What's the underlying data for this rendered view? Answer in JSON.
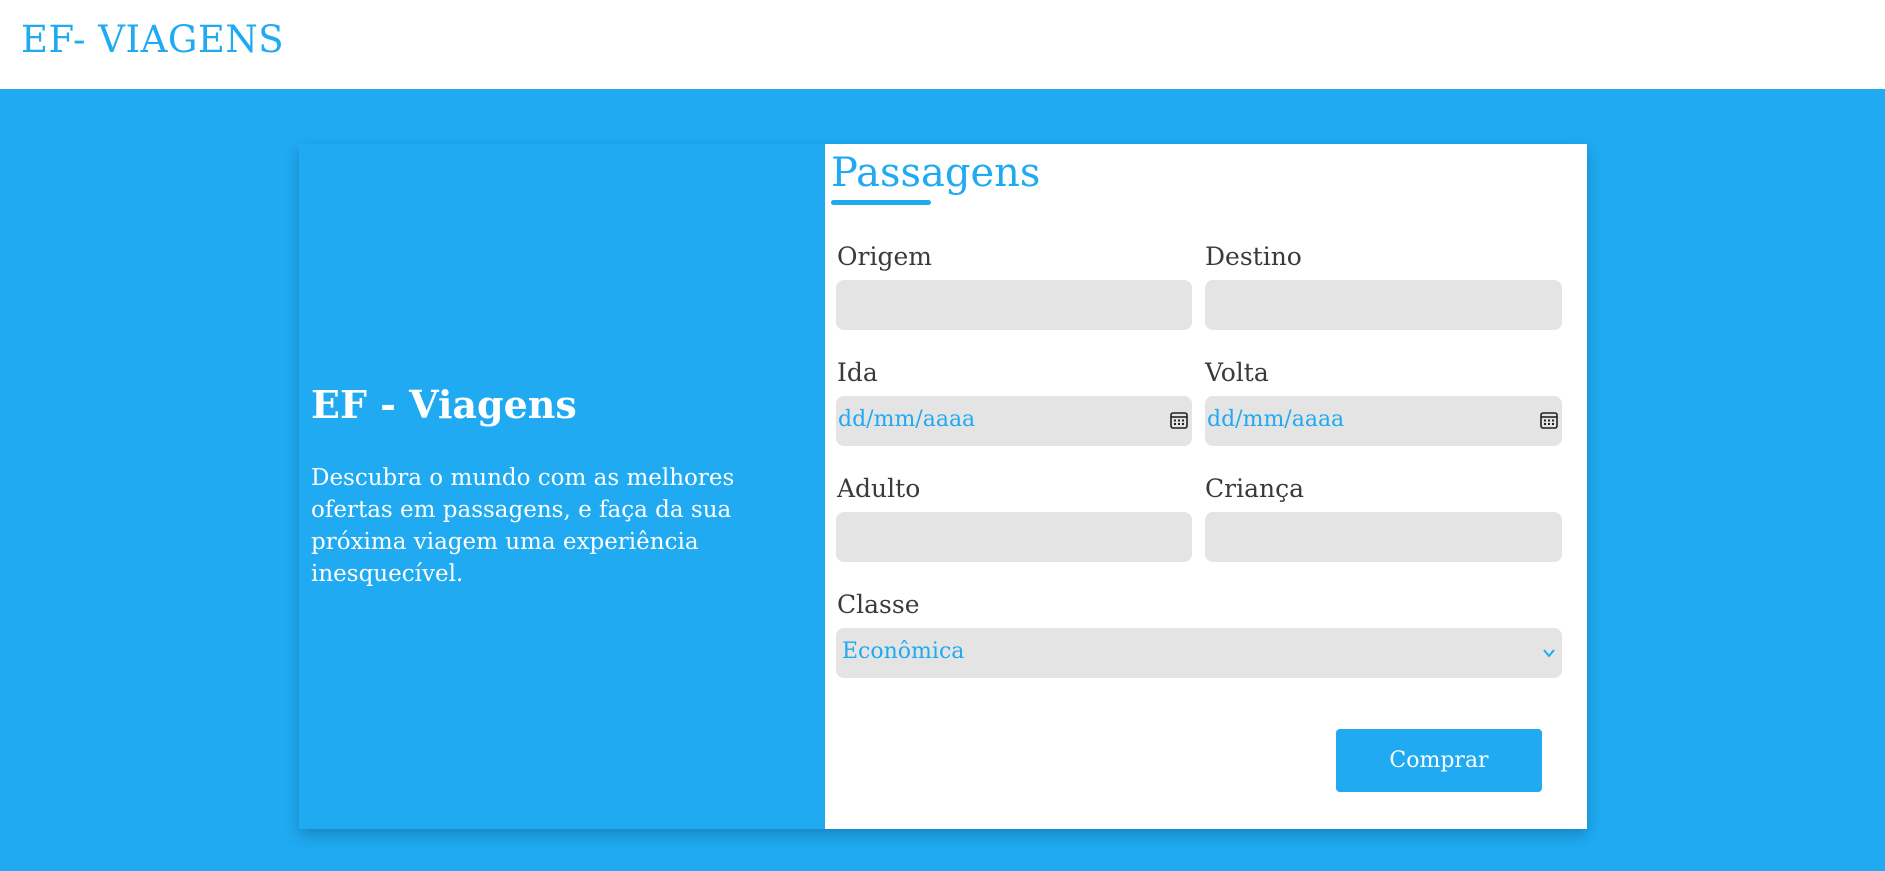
{
  "header": {
    "brand": "EF- VIAGENS"
  },
  "hero": {
    "title": "EF - Viagens",
    "description": "Descubra o mundo com as melhores ofertas em passagens, e faça da sua próxima viagem uma experiência inesquecível."
  },
  "form": {
    "title": "Passagens",
    "origem": {
      "label": "Origem",
      "value": ""
    },
    "destino": {
      "label": "Destino",
      "value": ""
    },
    "ida": {
      "label": "Ida",
      "placeholder": "dd/mm/aaaa"
    },
    "volta": {
      "label": "Volta",
      "placeholder": "dd/mm/aaaa"
    },
    "adulto": {
      "label": "Adulto",
      "value": ""
    },
    "crianca": {
      "label": "Criança",
      "value": ""
    },
    "classe": {
      "label": "Classe",
      "selected": "Econômica"
    },
    "submit_label": "Comprar"
  },
  "colors": {
    "accent": "#1faaf2",
    "input_bg": "#e4e4e4",
    "label_text": "#3a3a3a",
    "card_bg": "#ffffff"
  },
  "icons": {
    "date_picker": "calendar-icon",
    "select": "chevron-down-icon"
  }
}
